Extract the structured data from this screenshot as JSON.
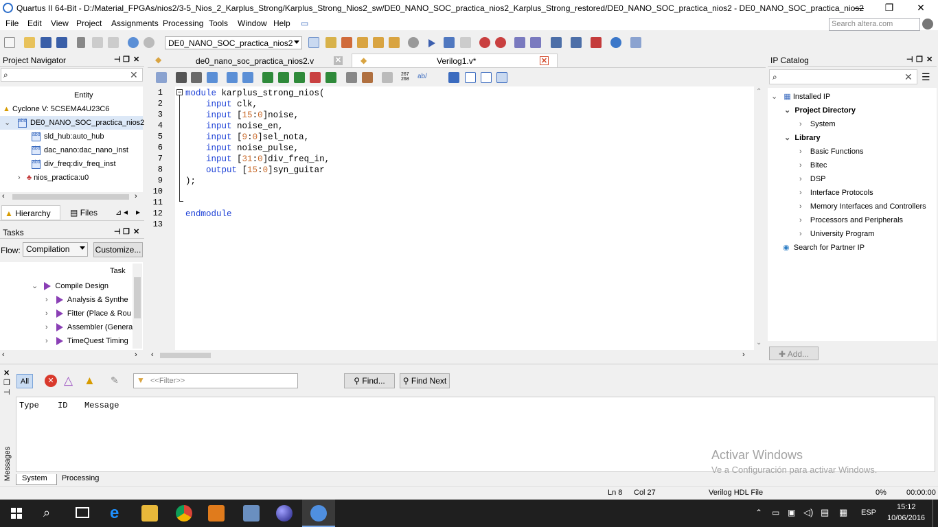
{
  "window": {
    "title": "Quartus II 64-Bit - D:/Material_FPGAs/nios2/3-5_Nios_2_Karplus_Strong/Karplus_Strong_Nios2_sw/DE0_NANO_SOC_practica_nios2_Karplus_Strong_restored/DE0_NANO_SOC_practica_nios2 - DE0_NANO_SOC_practica_nios2",
    "minimize": "—",
    "restore": "❐",
    "close": "✕"
  },
  "menu": [
    "File",
    "Edit",
    "View",
    "Project",
    "Assignments",
    "Processing",
    "Tools",
    "Window",
    "Help"
  ],
  "search": {
    "placeholder": "Search altera.com"
  },
  "toolbar": {
    "project_combo": "DE0_NANO_SOC_practica_nios2"
  },
  "project_navigator": {
    "title": "Project Navigator",
    "column": "Entity",
    "device": "Cyclone V: 5CSEMA4U23C6",
    "top": "DE0_NANO_SOC_practica_nios2",
    "children": [
      "sld_hub:auto_hub",
      "dac_nano:dac_nano_inst",
      "div_freq:div_freq_inst",
      "nios_practica:u0"
    ],
    "tabs": [
      "Hierarchy",
      "Files"
    ]
  },
  "tasks": {
    "title": "Tasks",
    "flow_label": "Flow:",
    "flow_value": "Compilation",
    "customize": "Customize...",
    "column": "Task",
    "group": "Compile Design",
    "items": [
      "Analysis & Synthe",
      "Fitter (Place & Rou",
      "Assembler (Genera",
      "TimeQuest Timing"
    ]
  },
  "editor": {
    "tabs": [
      "de0_nano_soc_practica_nios2.v",
      "Verilog1.v*"
    ],
    "line_numbers": [
      "1",
      "2",
      "3",
      "4",
      "5",
      "6",
      "7",
      "8",
      "9",
      "10",
      "11",
      "12",
      "13"
    ]
  },
  "ip_catalog": {
    "title": "IP Catalog",
    "installed": "Installed IP",
    "project_dir": "Project Directory",
    "system": "System",
    "library": "Library",
    "library_items": [
      "Basic Functions",
      "Bitec",
      "DSP",
      "Interface Protocols",
      "Memory Interfaces and Controllers",
      "Processors and Peripherals",
      "University Program"
    ],
    "partner": "Search for Partner IP",
    "add": "Add..."
  },
  "messages": {
    "all": "All",
    "filter_placeholder": "<<Filter>>",
    "find": "Find...",
    "find_next": "Find Next",
    "columns": [
      "Type",
      "ID",
      "Message"
    ],
    "side_label": "Messages",
    "tabs": [
      "System",
      "Processing"
    ]
  },
  "watermark": {
    "line1": "Activar Windows",
    "line2": "Ve a Configuración para activar Windows."
  },
  "status": {
    "line": "Ln 8",
    "col": "Col 27",
    "lang": "Verilog HDL File",
    "progress": "0%",
    "time": "00:00:00"
  },
  "taskbar": {
    "lang": "ESP",
    "time": "15:12",
    "date": "10/06/2016"
  }
}
